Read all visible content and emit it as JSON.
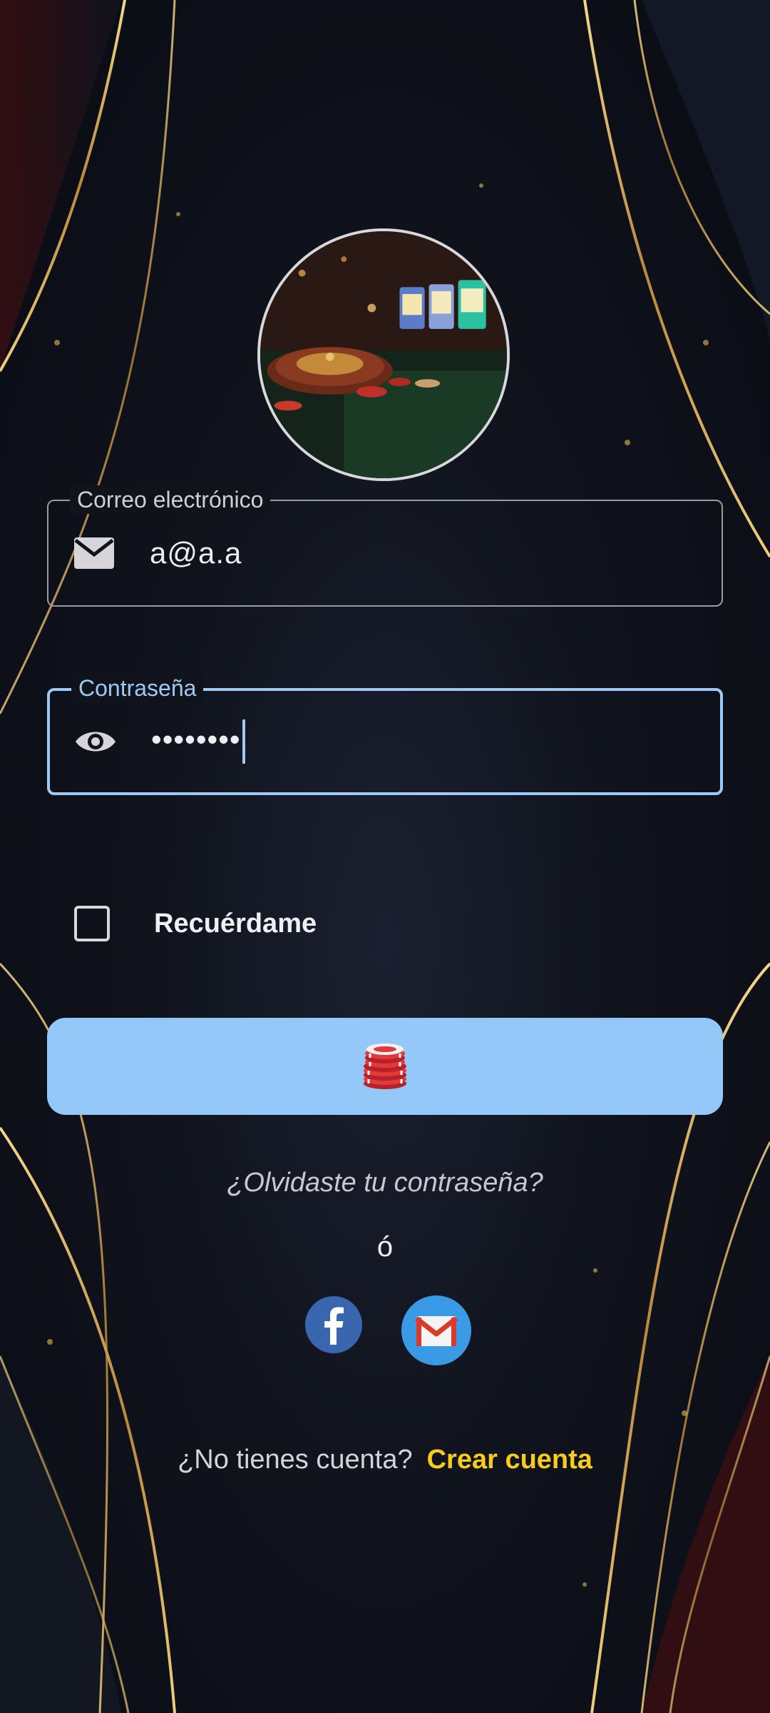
{
  "email": {
    "label": "Correo electrónico",
    "value": "a@a.a"
  },
  "password": {
    "label": "Contraseña",
    "value": "••••••••"
  },
  "remember": {
    "label": "Recuérdame",
    "checked": false
  },
  "login_button": {
    "icon": "casino-chips-icon"
  },
  "forgot_password": "¿Olvidaste tu contraseña?",
  "or_separator": "ó",
  "social": {
    "facebook_icon": "facebook-icon",
    "gmail_icon": "gmail-icon"
  },
  "signup": {
    "question": "¿No tienes cuenta?",
    "link": "Crear cuenta"
  },
  "colors": {
    "accent": "#94c8f8",
    "link": "#f8cc1c",
    "gold": "#c9a24a"
  }
}
